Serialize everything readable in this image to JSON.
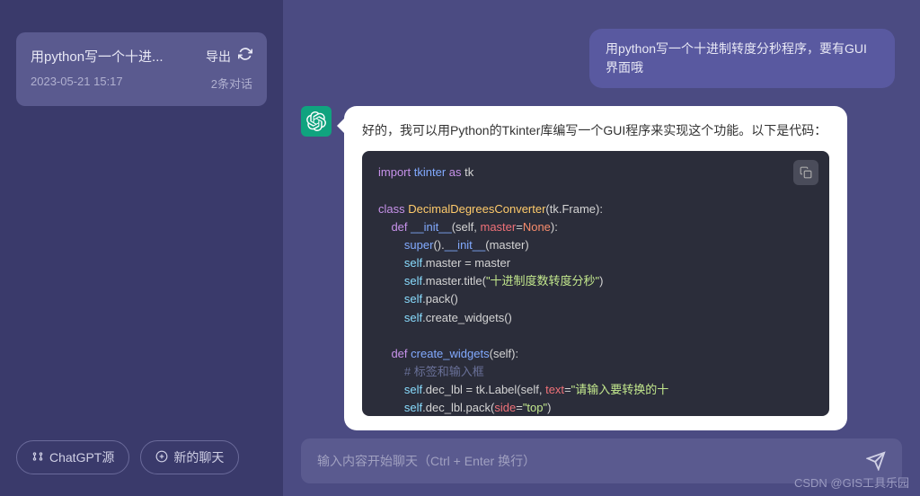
{
  "sidebar": {
    "conversation": {
      "title": "用python写一个十进...",
      "export_label": "导出",
      "timestamp": "2023-05-21 15:17",
      "count_label": "2条对话"
    },
    "source_button": "ChatGPT源",
    "new_chat_button": "新的聊天"
  },
  "chat": {
    "user_message": "用python写一个十进制转度分秒程序，要有GUI界面哦",
    "assistant_intro": "好的，我可以用Python的Tkinter库编写一个GUI程序来实现这个功能。以下是代码：",
    "code": {
      "l1a": "import",
      "l1b": "tkinter",
      "l1c": "as",
      "l1d": "tk",
      "l2a": "class",
      "l2b": "DecimalDegreesConverter",
      "l2c": "(tk.Frame):",
      "l3a": "def",
      "l3b": "__init__",
      "l3c": "(self,",
      "l3d": "master",
      "l3e": "None",
      "l3f": "):",
      "l4a": "super",
      "l4b": "().",
      "l4c": "__init__",
      "l4d": "(master)",
      "l5a": "self",
      "l5b": ".master = master",
      "l6a": "self",
      "l6b": ".master.title(",
      "l6c": "\"十进制度数转度分秒\"",
      "l6d": ")",
      "l7a": "self",
      "l7b": ".pack()",
      "l8a": "self",
      "l8b": ".create_widgets()",
      "l9a": "def",
      "l9b": "create_widgets",
      "l9c": "(self):",
      "l10": "# 标签和输入框",
      "l11a": "self",
      "l11b": ".dec_lbl = tk.Label(self,",
      "l11c": "text",
      "l11d": "=",
      "l11e": "\"请输入要转换的十",
      "l12a": "self",
      "l12b": ".dec_lbl.pack(",
      "l12c": "side",
      "l12d": "=",
      "l12e": "\"top\"",
      "l12f": ")"
    }
  },
  "input": {
    "placeholder": "输入内容开始聊天（Ctrl + Enter 换行）"
  },
  "watermark": "CSDN @GIS工具乐园"
}
